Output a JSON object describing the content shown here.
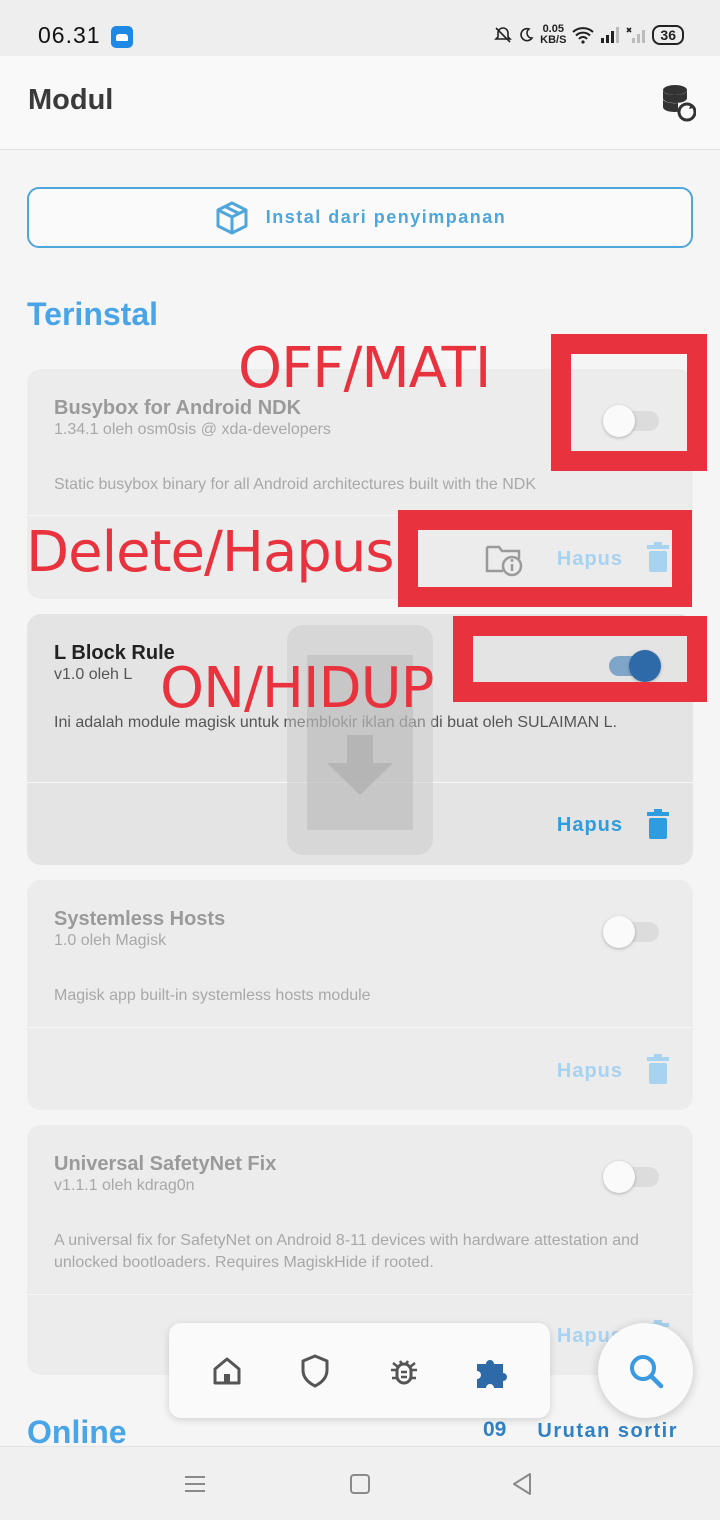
{
  "status": {
    "time": "06.31",
    "net_speed_value": "0.05",
    "net_speed_unit": "KB/S",
    "battery": "36"
  },
  "appbar": {
    "title": "Modul",
    "action_icon": "database-refresh-icon"
  },
  "install": {
    "label": "Instal dari penyimpanan",
    "icon": "package-icon"
  },
  "sections": {
    "installed": "Terinstal",
    "online": "Online"
  },
  "modules": [
    {
      "name": "Busybox for Android NDK",
      "version": "1.34.1 oleh osm0sis @ xda-developers",
      "description": "Static busybox binary for all Android architectures built with the NDK",
      "enabled": false,
      "remove_label": "Hapus"
    },
    {
      "name": "L Block Rule",
      "version": "v1.0 oleh L",
      "description": "Ini adalah module magisk untuk memblokir iklan dan di buat oleh SULAIMAN L.",
      "enabled": true,
      "remove_label": "Hapus"
    },
    {
      "name": "Systemless Hosts",
      "version": "1.0 oleh Magisk",
      "description": "Magisk app built-in systemless hosts module",
      "enabled": false,
      "remove_label": "Hapus"
    },
    {
      "name": "Universal SafetyNet Fix",
      "version": "v1.1.1 oleh kdrag0n",
      "description": "A universal fix for SafetyNet on Android 8-11 devices with hardware attestation and unlocked bootloaders. Requires MagiskHide if rooted.",
      "enabled": false,
      "remove_label": "Hapus"
    }
  ],
  "annotations": {
    "off": "OFF/MATI",
    "delete": "Delete/Hapus",
    "on": "ON/HIDUP"
  },
  "sort": {
    "icon_text": "09",
    "label": "Urutan sortir"
  },
  "colors": {
    "accent": "#4aa5e8",
    "annotation_red": "#e8333f",
    "toggle_on": "#2f6aa8"
  },
  "nav_icons": [
    "home-icon",
    "shield-icon",
    "bug-icon",
    "puzzle-icon"
  ]
}
